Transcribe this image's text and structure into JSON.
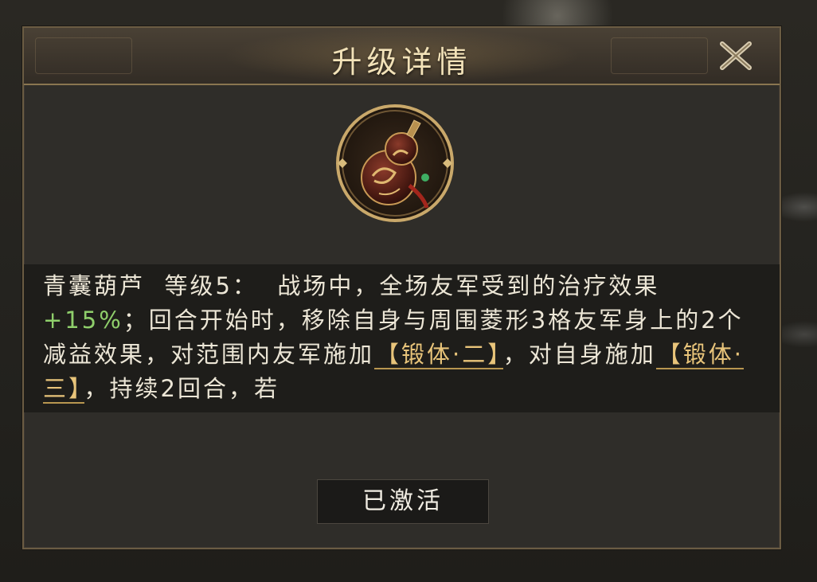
{
  "dialog": {
    "title": "升级详情",
    "close_icon": "close-x-icon"
  },
  "item": {
    "icon": "gourd-icon",
    "name": "青囊葫芦",
    "level": "等级5："
  },
  "description": {
    "part1": "战场中，全场友军受到的治疗效果",
    "bonus": "+15%",
    "part2": "；回合开始时，移除自身与周围菱形3格友军身上的2个减益效果，对范围内友军施加",
    "tag1": "【锻体·二】",
    "part3": "，对自身施加",
    "tag2": "【锻体·三】",
    "part4": "，持续2回合，若"
  },
  "footer": {
    "status_button": "已激活"
  },
  "colors": {
    "title": "#f2e2b8",
    "bonus_green": "#8fcf6b",
    "tag_gold": "#e8c47a",
    "panel_border": "#6b5c43"
  }
}
